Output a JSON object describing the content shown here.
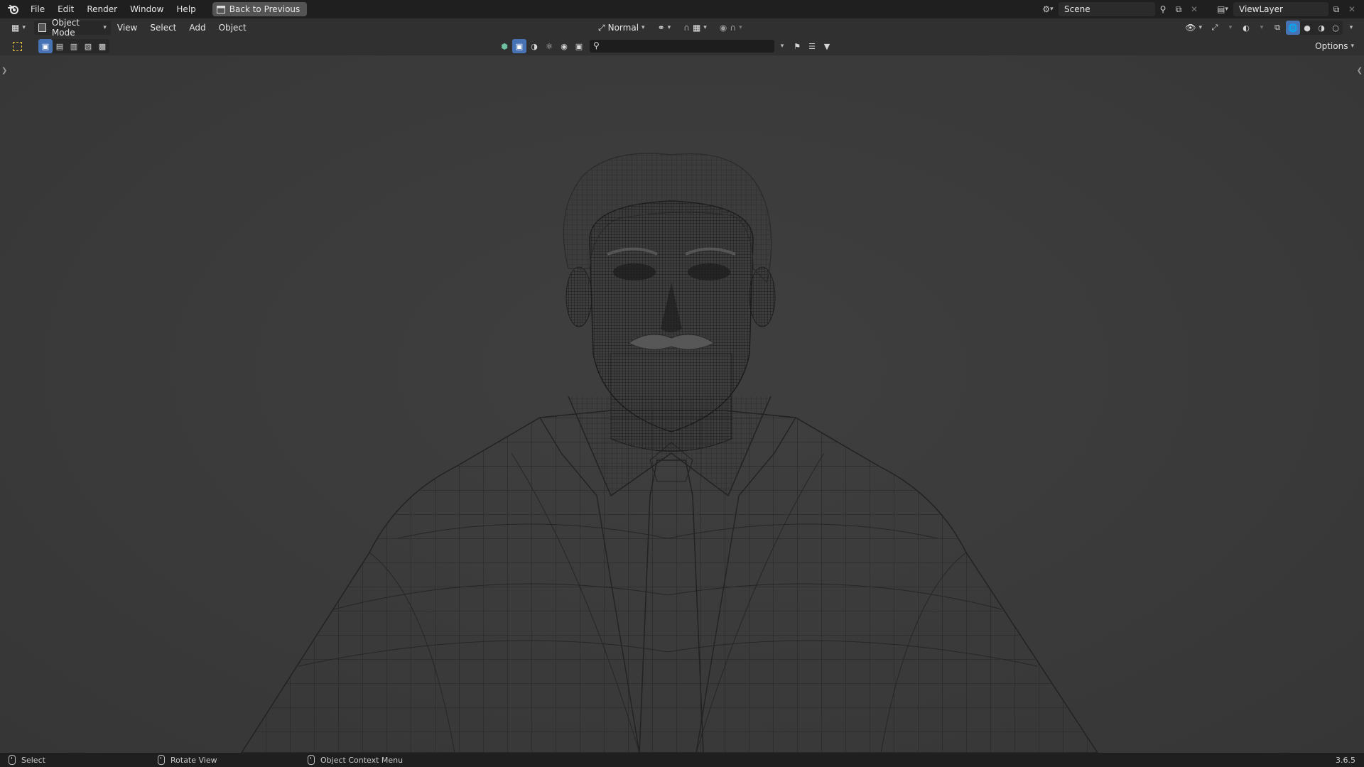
{
  "topbar": {
    "logo_icon": "blender-logo-icon",
    "menus": [
      "File",
      "Edit",
      "Render",
      "Window",
      "Help"
    ],
    "back_button": "Back to Previous",
    "scene_name": "Scene",
    "view_layer": "ViewLayer"
  },
  "header": {
    "mode": "Object Mode",
    "menus": [
      "View",
      "Select",
      "Add",
      "Object"
    ],
    "transform_orientation": "Normal",
    "options_label": "Options",
    "search_placeholder": ""
  },
  "statusbar": {
    "left_click": "Select",
    "middle_click": "Rotate View",
    "right_click": "Object Context Menu",
    "version": "3.6.5"
  },
  "colors": {
    "accent": "#4772b3",
    "topbar": "#1f1f1f",
    "header": "#303030",
    "viewport": "#3d3d3d",
    "wire": "#1a1a1a"
  }
}
